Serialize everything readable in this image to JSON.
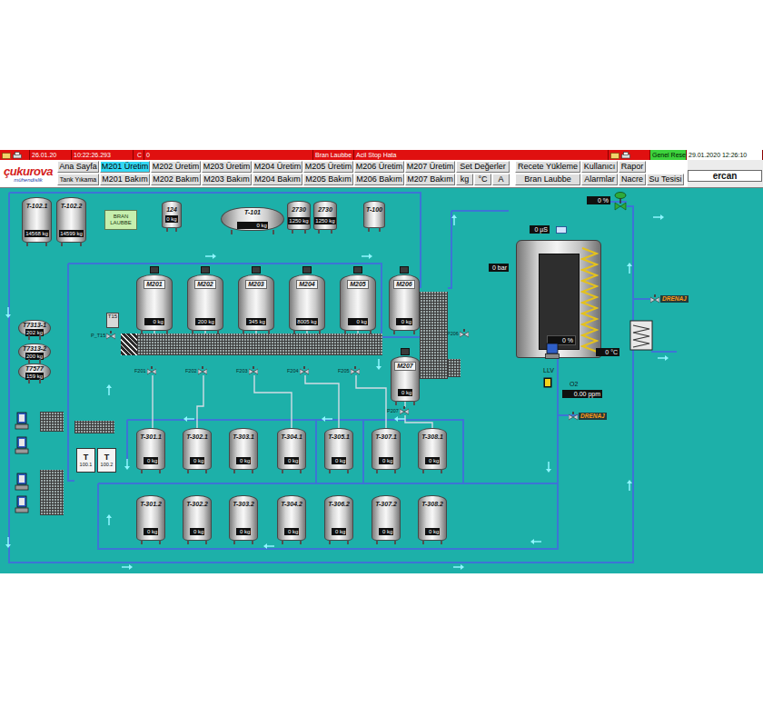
{
  "status_bar": {
    "cells": [
      {
        "text": "26.01.20"
      },
      {
        "text": "10:22:26.293"
      },
      {
        "text": "C"
      },
      {
        "text": "0"
      },
      {
        "text": "Bran Laubbe"
      },
      {
        "text": "Acil Stop Hata"
      }
    ],
    "reset": "Genel Reset",
    "datetime": "29.01.2020 12:26:10"
  },
  "logo": {
    "name": "çukurova",
    "sub": "mühendislik"
  },
  "menu": {
    "rows": [
      [
        {
          "label": "Ana Sayfa",
          "selected": false,
          "kind": "button"
        },
        {
          "label": "M201 Üretim",
          "selected": true,
          "kind": "button"
        },
        {
          "label": "M202 Üretim",
          "selected": false,
          "kind": "button"
        },
        {
          "label": "M203 Üretim",
          "selected": false,
          "kind": "button"
        },
        {
          "label": "M204 Üretim",
          "selected": false,
          "kind": "button"
        },
        {
          "label": "M205 Üretim",
          "selected": false,
          "kind": "button"
        },
        {
          "label": "M206 Üretim",
          "selected": false,
          "kind": "button"
        },
        {
          "label": "M207 Üretim",
          "selected": false,
          "kind": "button"
        },
        {
          "label": "Set Değerler",
          "selected": false,
          "kind": "button"
        },
        {
          "label": "Recete Yükleme",
          "selected": false,
          "kind": "button"
        },
        {
          "label": "Kullanıcı",
          "selected": false,
          "kind": "button"
        },
        {
          "label": "Rapor",
          "selected": false,
          "kind": "button"
        }
      ],
      [
        {
          "label": "Tank Yıkama",
          "selected": false,
          "kind": "compact"
        },
        {
          "label": "M201 Bakım",
          "selected": false,
          "kind": "button"
        },
        {
          "label": "M202 Bakım",
          "selected": false,
          "kind": "button"
        },
        {
          "label": "M203 Bakım",
          "selected": false,
          "kind": "button"
        },
        {
          "label": "M204 Bakım",
          "selected": false,
          "kind": "button"
        },
        {
          "label": "M205 Bakım",
          "selected": false,
          "kind": "button"
        },
        {
          "label": "M206 Bakım",
          "selected": false,
          "kind": "button"
        },
        {
          "label": "M207 Bakım",
          "selected": false,
          "kind": "button"
        },
        {
          "label": "kg",
          "selected": false,
          "kind": "button"
        },
        {
          "label": "°C",
          "selected": false,
          "kind": "button"
        },
        {
          "label": "A",
          "selected": false,
          "kind": "button"
        },
        {
          "label": "Bran Laubbe",
          "selected": false,
          "kind": "button"
        },
        {
          "label": "Alarmlar",
          "selected": false,
          "kind": "button"
        },
        {
          "label": "Nacre",
          "selected": false,
          "kind": "button"
        },
        {
          "label": "Su Tesisi",
          "selected": false,
          "kind": "button"
        }
      ]
    ]
  },
  "user": "ercan",
  "top_tanks": [
    {
      "label": "T-102.1",
      "value": "14568 kg",
      "kind": "vertical"
    },
    {
      "label": "T-102.2",
      "value": "14599 kg",
      "kind": "vertical"
    },
    {
      "label": "124",
      "value": "0 kg",
      "kind": "vertical"
    },
    {
      "label": "T-101",
      "value": "0 kg",
      "kind": "horizontal"
    },
    {
      "label": "2730",
      "value": "1250 kg",
      "kind": "vertical"
    },
    {
      "label": "2730",
      "value": "1250 kg",
      "kind": "vertical"
    },
    {
      "label": "T-100",
      "value": "",
      "kind": "vertical"
    }
  ],
  "bran_button": "BRAN LAUBBE",
  "side_tanks": [
    {
      "label": "T7313-1",
      "value": "202 kg"
    },
    {
      "label": "T7313-2",
      "value": "200 kg"
    },
    {
      "label": "T7577",
      "value": "159 kg"
    }
  ],
  "mixers": [
    {
      "label": "M201",
      "value": "0 kg"
    },
    {
      "label": "M202",
      "value": "200 kg"
    },
    {
      "label": "M203",
      "value": "345 kg"
    },
    {
      "label": "M204",
      "value": "8005 kg"
    },
    {
      "label": "M205",
      "value": "0 kg"
    },
    {
      "label": "M206",
      "value": "0 kg"
    },
    {
      "label": "M207",
      "value": "0 kg"
    }
  ],
  "t15": "T15",
  "valves": [
    {
      "label": "P_T15"
    },
    {
      "label": "F201"
    },
    {
      "label": "F202"
    },
    {
      "label": "F203"
    },
    {
      "label": "F204"
    },
    {
      "label": "F205"
    },
    {
      "label": "P207"
    },
    {
      "label": "P206"
    }
  ],
  "product_tanks": {
    "row1": [
      {
        "label": "T-301.1",
        "value": "0 kg"
      },
      {
        "label": "T-302.1",
        "value": "0 kg"
      },
      {
        "label": "T-303.1",
        "value": "0 kg"
      },
      {
        "label": "T-304.1",
        "value": "0 kg"
      },
      {
        "label": "T-305.1",
        "value": "0 kg"
      },
      {
        "label": "T-307.1",
        "value": "0 kg"
      },
      {
        "label": "T-308.1",
        "value": "0 kg"
      }
    ],
    "row2": [
      {
        "label": "T-301.2",
        "value": "0 kg"
      },
      {
        "label": "T-302.2",
        "value": "0 kg"
      },
      {
        "label": "T-303.2",
        "value": "0 kg"
      },
      {
        "label": "T-304.2",
        "value": "0 kg"
      },
      {
        "label": "T-306.2",
        "value": "0 kg"
      },
      {
        "label": "T-307.2",
        "value": "0 kg"
      },
      {
        "label": "T-308.2",
        "value": "0 kg"
      }
    ]
  },
  "filters": [
    {
      "symbol": "T",
      "label": "100.1"
    },
    {
      "symbol": "T",
      "label": "100.2"
    }
  ],
  "pumps": [
    {
      "running": false
    },
    {
      "running": false
    },
    {
      "running": false
    },
    {
      "running": false
    }
  ],
  "treatment": {
    "level": 0,
    "level_text": "0 %",
    "conductivity": "0 µS",
    "pressure": "0 bar",
    "valve_opening": "0 %",
    "temperature": "0 °C",
    "oxygen_label": "O2",
    "oxygen": "0.00 ppm",
    "pump_label": "LLV",
    "drains": [
      "DRENAJ",
      "DRENAJ"
    ]
  }
}
